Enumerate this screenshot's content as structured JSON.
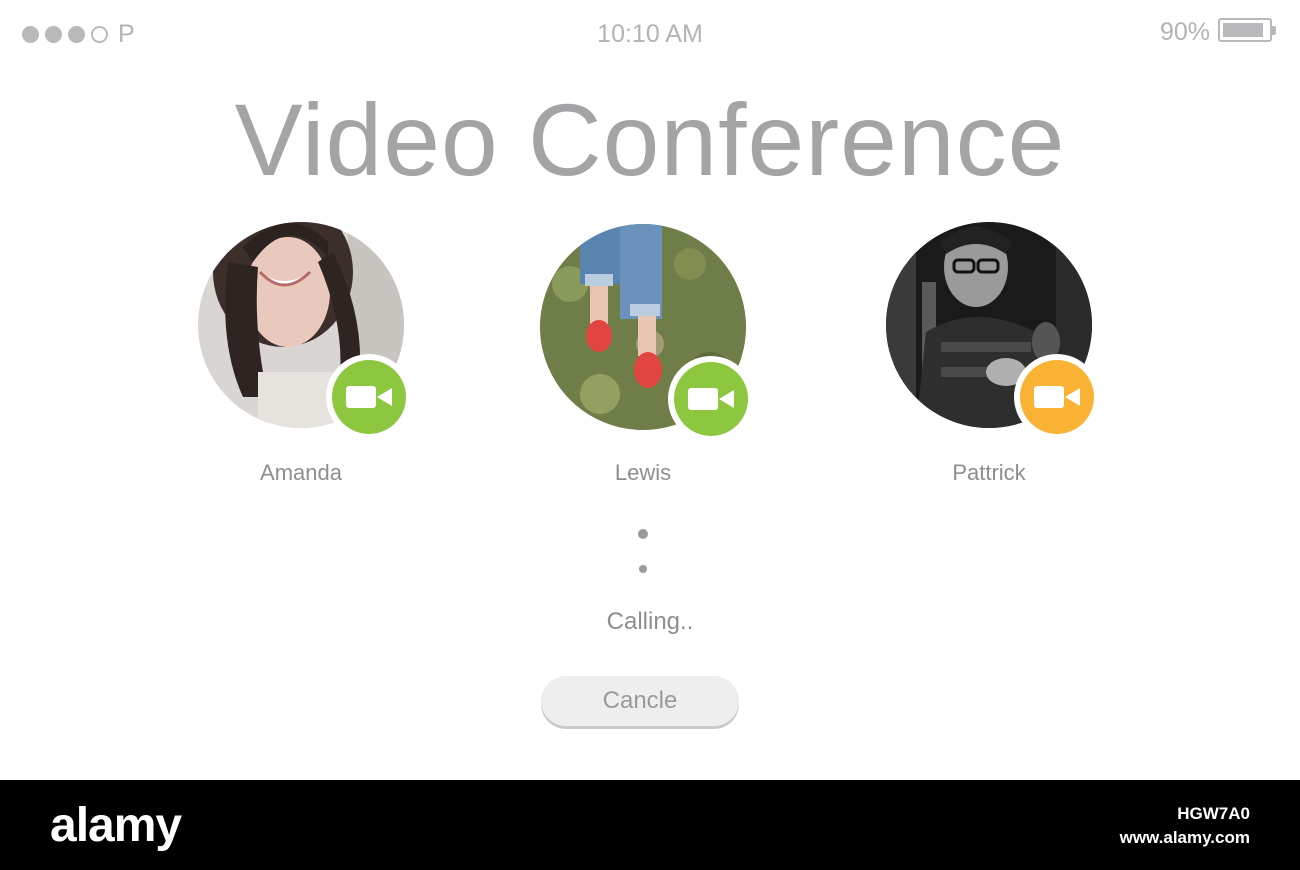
{
  "status_bar": {
    "carrier": "P",
    "signal_filled": 3,
    "signal_total": 4,
    "time": "10:10 AM",
    "battery_percent": "90%",
    "battery_level": 0.9
  },
  "title": "Video Conference",
  "participants": [
    {
      "name": "Amanda",
      "status_color": "#8dc63f",
      "icon": "video-camera-icon"
    },
    {
      "name": "Lewis",
      "status_color": "#8dc63f",
      "icon": "video-camera-icon"
    },
    {
      "name": "Pattrick",
      "status_color": "#f9b233",
      "icon": "video-camera-icon"
    }
  ],
  "call": {
    "status_text": "Calling..",
    "cancel_label": "Cancle"
  },
  "watermark": {
    "logo": "alamy",
    "image_id": "HGW7A0",
    "url": "www.alamy.com"
  }
}
